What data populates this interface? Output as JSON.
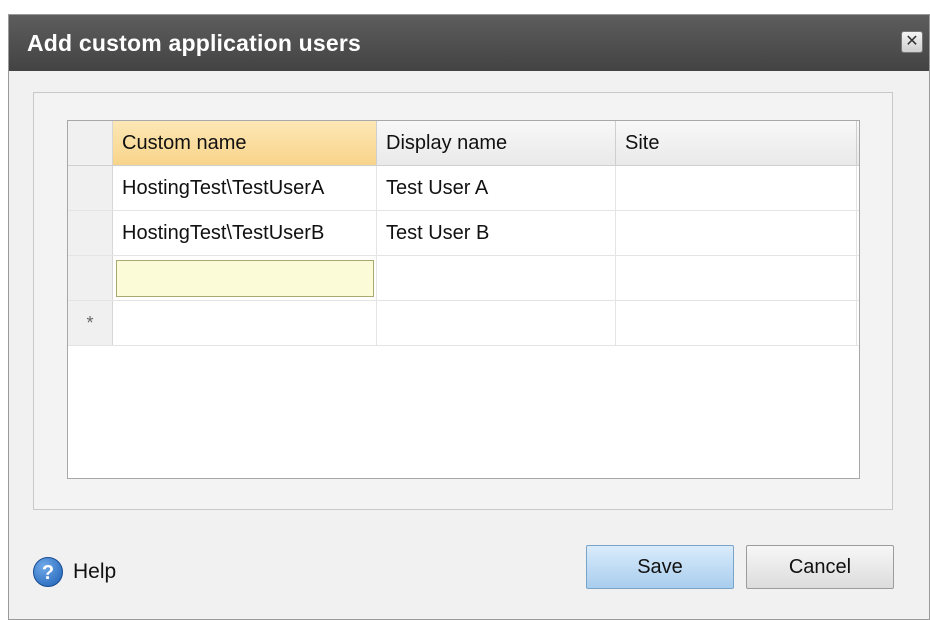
{
  "dialog": {
    "title": "Add custom application users",
    "close_symbol": "✕"
  },
  "grid": {
    "columns": [
      "Custom name",
      "Display name",
      "Site"
    ],
    "rows": [
      {
        "selector": "",
        "custom_name": "HostingTest\\TestUserA",
        "display_name": "Test User A",
        "site": ""
      },
      {
        "selector": "",
        "custom_name": "HostingTest\\TestUserB",
        "display_name": "Test User B",
        "site": ""
      },
      {
        "selector": "",
        "custom_name": "",
        "display_name": "",
        "site": ""
      },
      {
        "selector": "*",
        "custom_name": "",
        "display_name": "",
        "site": ""
      }
    ]
  },
  "footer": {
    "help_label": "Help",
    "help_icon_glyph": "?",
    "save_label": "Save",
    "cancel_label": "Cancel"
  }
}
